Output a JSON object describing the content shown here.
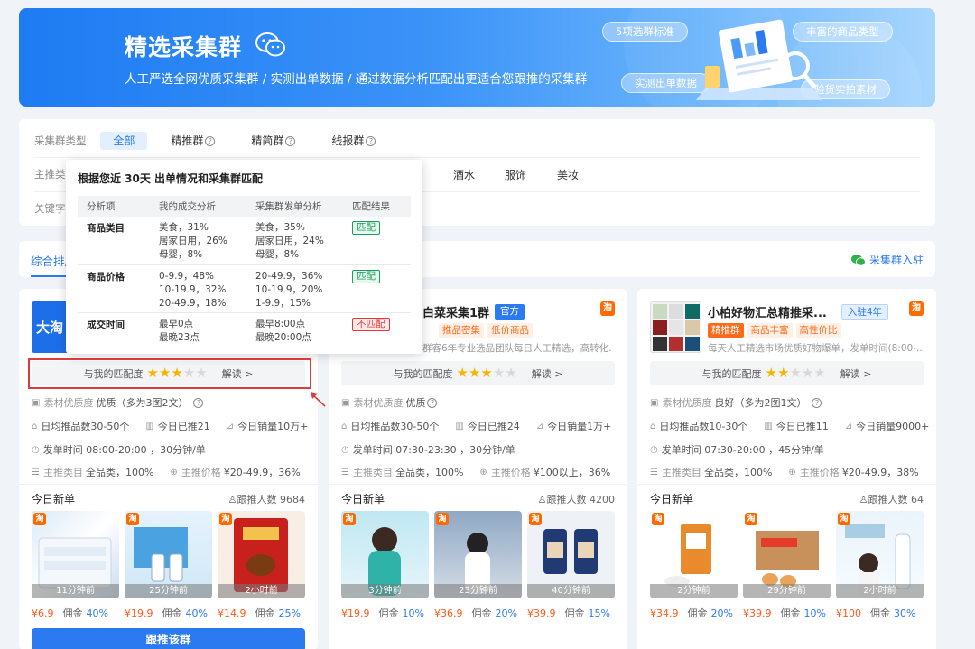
{
  "banner": {
    "title": "精选采集群",
    "subtitle": "人工严选全网优质采集群 / 实测出单数据 / 通过数据分析匹配出更适合您跟推的采集群",
    "pills": [
      "5项选群标准",
      "丰富的商品类型",
      "实测出单数据",
      "验货实拍素材"
    ]
  },
  "filters": {
    "type_label": "采集群类型:",
    "types": [
      "全部",
      "精推群",
      "精简群",
      "线报群"
    ],
    "category_label": "主推类",
    "categories": [
      "酒水",
      "服饰",
      "美妆"
    ],
    "keyword_label": "关键字"
  },
  "tabs": {
    "sort_label": "综合排序",
    "join_label": "采集群入驻"
  },
  "popup": {
    "title": "根据您近 30天 出单情况和采集群匹配",
    "headers": [
      "分析项",
      "我的成交分析",
      "采集群发单分析",
      "匹配结果"
    ],
    "rows": [
      {
        "item": "商品类目",
        "mine": [
          "美食，31%",
          "居家日用，26%",
          "母婴，8%"
        ],
        "group": [
          "美食，35%",
          "居家日用，24%",
          "母婴，8%"
        ],
        "result": "匹配"
      },
      {
        "item": "商品价格",
        "mine": [
          "0-9.9，48%",
          "10-19.9，32%",
          "20-49.9，18%"
        ],
        "group": [
          "20-49.9，36%",
          "10-19.9，20%",
          "1-9.9，15%"
        ],
        "result": "匹配"
      },
      {
        "item": "成交时间",
        "mine": [
          "最早0点",
          "最晚23点"
        ],
        "group": [
          "最早8:00点",
          "最晚20:00点"
        ],
        "result": "不匹配"
      }
    ]
  },
  "cards": [
    {
      "logo_text": "大淘",
      "match_label": "与我的匹配度",
      "stars": 3,
      "read_label": "解读 >",
      "material": "素材优质度",
      "material_val": "优质（多为3图2文）",
      "daily": "日均推品数30-50个",
      "today_push": "今日已推21",
      "sales": "今日销量10万+",
      "time": "发单时间 08:00-20:00 ，30分钟/单",
      "cat": "主推类目",
      "cat_val": "全品类，100%",
      "price_k": "主推价格",
      "price_v": "¥20-49.9，36%",
      "today_label": "今日新单",
      "fans": "跟推人数 9684",
      "products": [
        {
          "ago": "11分钟前",
          "price": "¥6.9",
          "comm_label": "佣金",
          "comm": "40%"
        },
        {
          "ago": "25分钟前",
          "price": "¥19.9",
          "comm_label": "佣金",
          "comm": "40%"
        },
        {
          "ago": "2小时前",
          "price": "¥14.9",
          "comm_label": "佣金",
          "comm": "25%"
        }
      ],
      "follow": "跟推该群"
    },
    {
      "name": "白菜采集1群",
      "badge": "官方",
      "tags": [
        "推品密集",
        "低价商品"
      ],
      "desc": "群客6年专业选品团队每日人工精选，高转化...",
      "match_label": "与我的匹配度",
      "stars": 3,
      "read_label": "解读 >",
      "material": "素材优质度",
      "material_val": "优质",
      "daily": "日均推品数30-50个",
      "today_push": "今日已推24",
      "sales": "今日销量1万+",
      "time": "发单时间 07:30-23:30 ，30分钟/单",
      "cat": "主推类目",
      "cat_val": "全品类，100%",
      "price_k": "主推价格",
      "price_v": "¥100以上，36%",
      "today_label": "今日新单",
      "fans": "跟推人数 4200",
      "products": [
        {
          "ago": "3分钟前",
          "price": "¥19.9",
          "comm_label": "佣金",
          "comm": "10%"
        },
        {
          "ago": "23分钟前",
          "price": "¥36.9",
          "comm_label": "佣金",
          "comm": "20%"
        },
        {
          "ago": "40分钟前",
          "price": "¥39.9",
          "comm_label": "佣金",
          "comm": "15%"
        }
      ]
    },
    {
      "name": "小柏好物汇总精推采...",
      "badge": "入驻4年",
      "tags": [
        "精推群",
        "商品丰富",
        "高性价比"
      ],
      "desc": "每天人工精选市场优质好物爆单，发单时间(8:00-...",
      "match_label": "与我的匹配度",
      "stars": 2,
      "read_label": "解读 >",
      "material": "素材优质度",
      "material_val": "良好（多为2图1文）",
      "daily": "日均推品数10-30个",
      "today_push": "今日已推11",
      "sales": "今日销量9000+",
      "time": "发单时间 07:30-20:00 ，45分钟/单",
      "cat": "主推类目",
      "cat_val": "全品类，100%",
      "price_k": "主推价格",
      "price_v": "¥20-49.9，38%",
      "today_label": "今日新单",
      "fans": "跟推人数 64",
      "products": [
        {
          "ago": "2分钟前",
          "price": "¥34.9",
          "comm_label": "佣金",
          "comm": "20%"
        },
        {
          "ago": "29分钟前",
          "price": "¥39.9",
          "comm_label": "佣金",
          "comm": "10%"
        },
        {
          "ago": "2小时前",
          "price": "¥100",
          "comm_label": "佣金",
          "comm": "30%"
        }
      ]
    }
  ],
  "taobao_badge": "淘",
  "colors": {
    "primary": "#2b7af0",
    "orange": "#ff6a00",
    "price": "#ff5a1a",
    "match": "#17a05d",
    "mismatch": "#e33333"
  }
}
